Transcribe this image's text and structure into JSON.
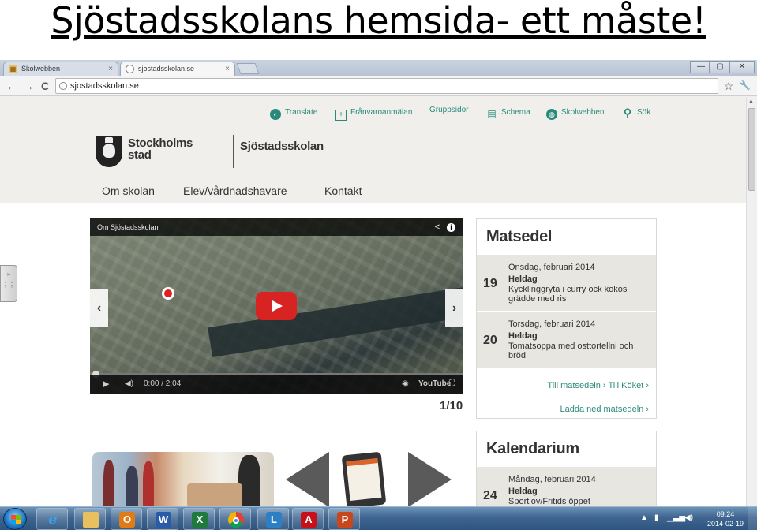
{
  "slide": {
    "title": "Sjöstadsskolans hemsida- ett måste!"
  },
  "browser": {
    "tabs": [
      {
        "label": "Skolwebben"
      },
      {
        "label": "sjostadsskolan.se"
      }
    ],
    "tab_close": "×",
    "window_controls": {
      "minimize": "—",
      "maximize": "▢",
      "close": "✕"
    },
    "nav": {
      "back": "←",
      "forward": "→",
      "reload": "C"
    },
    "address": "sjostadsskolan.se",
    "star": "☆",
    "wrench": "🔧"
  },
  "site": {
    "toplinks": [
      {
        "label": "Translate",
        "icon": "globe-icon",
        "glyph": "◐"
      },
      {
        "label": "Frånvaroanmälan",
        "icon": "plus-box-icon",
        "glyph": "+"
      },
      {
        "label": "Gruppsidor",
        "icon": "",
        "glyph": ""
      },
      {
        "label": "Schema",
        "icon": "calendar-icon",
        "glyph": "▤"
      },
      {
        "label": "Skolwebben",
        "icon": "globe-icon",
        "glyph": "◍"
      },
      {
        "label": "Sök",
        "icon": "search-icon",
        "glyph": "⚲"
      }
    ],
    "logo_line1": "Stockholms",
    "logo_line2": "stad",
    "school_name": "Sjöstadsskolan",
    "mainnav": [
      "Om skolan",
      "Elev/vårdnadshavare",
      "Kontakt"
    ],
    "video": {
      "title": "Om Sjöstadsskolan",
      "time": "0:00 / 2:04",
      "youtube": "YouTube"
    },
    "slide_counter": "1/10",
    "matsedel": {
      "heading": "Matsedel",
      "entries": [
        {
          "day": "19",
          "date": "Onsdag, februari 2014",
          "when": "Heldag",
          "desc": "Kycklinggryta i curry ock kokos grädde med ris"
        },
        {
          "day": "20",
          "date": "Torsdag, februari 2014",
          "when": "Heldag",
          "desc": "Tomatsoppa med osttortellni och bröd"
        }
      ],
      "link1": "Till matsedeln › Till Köket ›",
      "link2": "Ladda ned matsedeln ›"
    },
    "kalendarium": {
      "heading": "Kalendarium",
      "entry": {
        "day": "24",
        "date": "Måndag, februari 2014",
        "when": "Heldag",
        "desc": "Sportlov/Fritids öppet"
      }
    }
  },
  "taskbar": {
    "apps": [
      "ie-icon",
      "explorer-icon",
      "outlook-icon",
      "word-icon",
      "excel-icon",
      "chrome-icon",
      "lync-icon",
      "acrobat-icon",
      "powerpoint-icon"
    ],
    "time": "09:24",
    "date": "2014-02-19"
  }
}
